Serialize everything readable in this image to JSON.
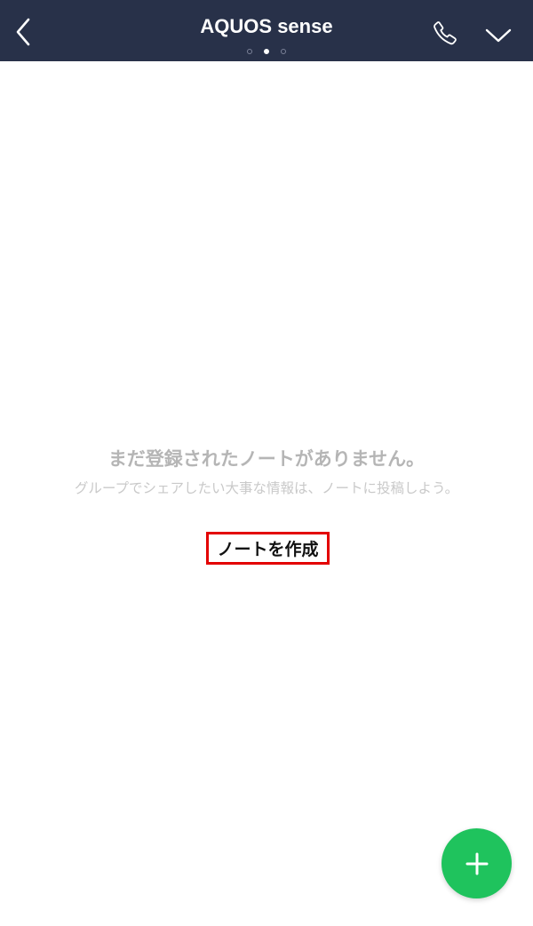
{
  "header": {
    "title": "AQUOS sense",
    "back_icon": "chevron-left-icon",
    "call_icon": "phone-icon",
    "menu_icon": "chevron-down-icon",
    "page_indicator": {
      "count": 3,
      "active_index": 1
    },
    "background_color": "#283149"
  },
  "empty_state": {
    "title": "まだ登録されたノートがありません。",
    "subtitle": "グループでシェアしたい大事な情報は、ノートに投稿しよう。",
    "create_label": "ノートを作成",
    "highlight_color": "#e30000"
  },
  "fab": {
    "icon": "plus-icon",
    "color": "#1fc35d"
  }
}
